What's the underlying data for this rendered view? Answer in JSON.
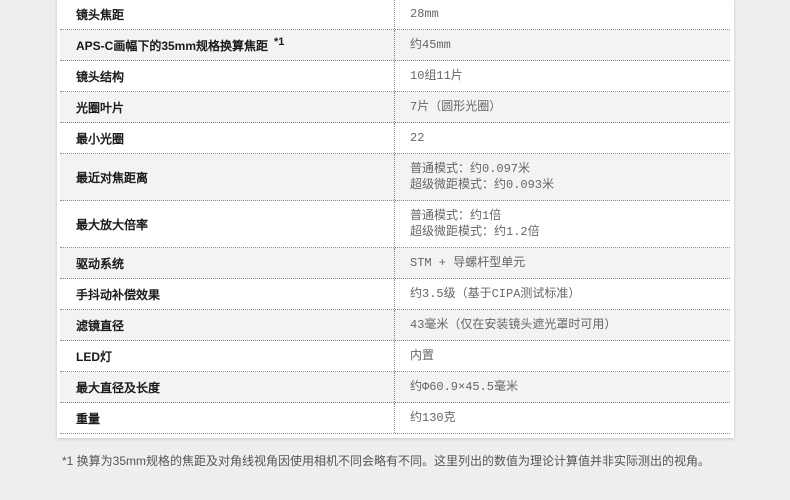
{
  "colors": {
    "page_background": "#eeeeee",
    "card_background": "#ffffff",
    "alt_row_background": "#f3f3f3",
    "label_text": "#1a1a1a",
    "value_text": "#666666",
    "divider": "#8a8a8a",
    "footnote_text": "#555555"
  },
  "spec_table": {
    "rows": [
      {
        "label": "镜头焦距",
        "values": [
          "28mm"
        ]
      },
      {
        "label": "APS-C画幅下的35mm规格换算焦距",
        "note_ref": "*1",
        "values": [
          "约45mm"
        ]
      },
      {
        "label": "镜头结构",
        "values": [
          "10组11片"
        ]
      },
      {
        "label": "光圈叶片",
        "values": [
          "7片（圆形光圈）"
        ]
      },
      {
        "label": "最小光圈",
        "values": [
          "22"
        ]
      },
      {
        "label": "最近对焦距离",
        "values": [
          "普通模式：约0.097米",
          "超级微距模式：约0.093米"
        ]
      },
      {
        "label": "最大放大倍率",
        "values": [
          "普通模式：约1倍",
          "超级微距模式：约1.2倍"
        ]
      },
      {
        "label": "驱动系统",
        "values": [
          "STM + 导螺杆型单元"
        ]
      },
      {
        "label": "手抖动补偿效果",
        "values": [
          "约3.5级（基于CIPA测试标准）"
        ]
      },
      {
        "label": "滤镜直径",
        "values": [
          "43毫米（仅在安装镜头遮光罩时可用）"
        ]
      },
      {
        "label": "LED灯",
        "values": [
          "内置"
        ]
      },
      {
        "label": "最大直径及长度",
        "values": [
          "约Φ60.9×45.5毫米"
        ]
      },
      {
        "label": "重量",
        "values": [
          "约130克"
        ]
      }
    ]
  },
  "footnote": "*1 换算为35mm规格的焦距及对角线视角因使用相机不同会略有不同。这里列出的数值为理论计算值并非实际测出的视角。"
}
